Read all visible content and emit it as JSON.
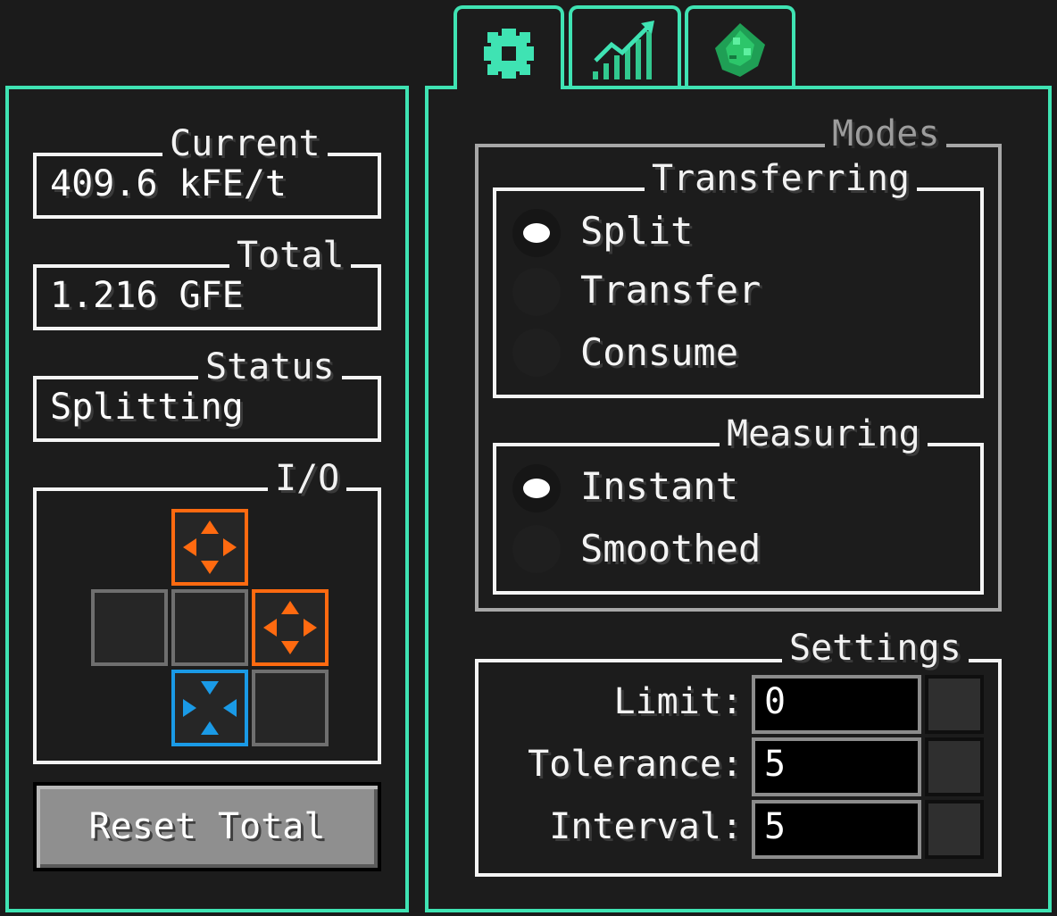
{
  "left_panel": {
    "current": {
      "legend": "Current",
      "value": "409.6 kFE/t"
    },
    "total": {
      "legend": "Total",
      "value": "1.216 GFE"
    },
    "status": {
      "legend": "Status",
      "value": "Splitting"
    },
    "io": {
      "legend": "I/O"
    },
    "reset_button": "Reset Total"
  },
  "tabs": [
    {
      "icon": "gear-icon",
      "active": true
    },
    {
      "icon": "stats-chart-icon",
      "active": false
    },
    {
      "icon": "emerald-dust-icon",
      "active": false
    }
  ],
  "modes": {
    "legend": "Modes",
    "transferring": {
      "legend": "Transferring",
      "options": [
        "Split",
        "Transfer",
        "Consume"
      ],
      "selected": "Split"
    },
    "measuring": {
      "legend": "Measuring",
      "options": [
        "Instant",
        "Smoothed"
      ],
      "selected": "Instant"
    }
  },
  "settings": {
    "legend": "Settings",
    "fields": [
      {
        "label": "Limit:",
        "value": "0"
      },
      {
        "label": "Tolerance:",
        "value": "5"
      },
      {
        "label": "Interval:",
        "value": "5"
      }
    ]
  },
  "colors": {
    "accent": "#3fe3b3",
    "output": "#ff6a10",
    "input": "#1a9ae6"
  }
}
